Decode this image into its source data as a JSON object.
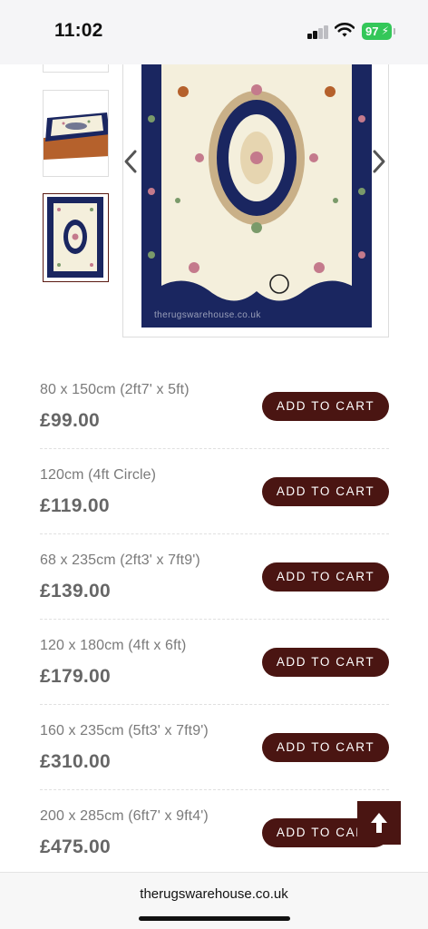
{
  "status": {
    "time": "11:02",
    "battery": "97",
    "battery_color": "#34c759"
  },
  "gallery": {
    "watermark": "therugswarehouse.co.uk",
    "prev_icon": "chevron-left-icon",
    "next_icon": "chevron-right-icon",
    "zoom_icon": "circle-icon"
  },
  "variants": [
    {
      "size": "80 x 150cm (2ft7' x 5ft)",
      "price": "£99.00",
      "button": "ADD TO CART"
    },
    {
      "size": "120cm (4ft Circle)",
      "price": "£119.00",
      "button": "ADD TO CART"
    },
    {
      "size": "68 x 235cm (2ft3' x 7ft9')",
      "price": "£139.00",
      "button": "ADD TO CART"
    },
    {
      "size": "120 x 180cm (4ft x 6ft)",
      "price": "£179.00",
      "button": "ADD TO CART"
    },
    {
      "size": "160 x 235cm (5ft3' x 7ft9')",
      "price": "£310.00",
      "button": "ADD TO CART"
    },
    {
      "size": "200 x 285cm (6ft7' x 9ft4')",
      "price": "£475.00",
      "button": "ADD TO CART"
    }
  ],
  "back_to_top_icon": "arrow-up-icon",
  "browser": {
    "url": "therugswarehouse.co.uk"
  },
  "colors": {
    "brand": "#4a1512",
    "rug_navy": "#1a2660",
    "rug_cream": "#f4efdc"
  }
}
